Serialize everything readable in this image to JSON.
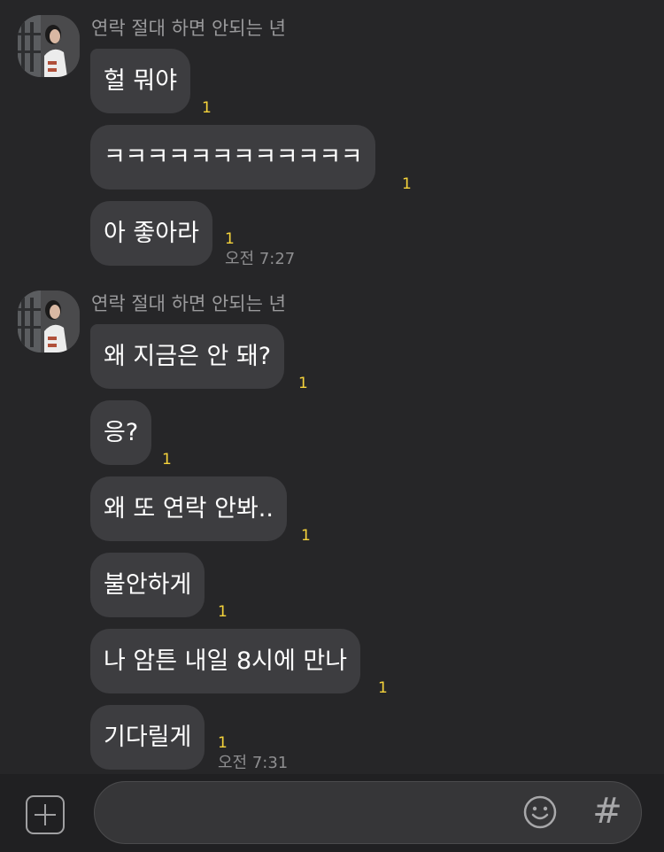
{
  "groups": [
    {
      "sender": "연락 절대 하면 안되는 년",
      "messages": [
        {
          "text": "헐 뭐야",
          "unread": "1"
        },
        {
          "text": "ㅋㅋㅋㅋㅋㅋㅋㅋㅋㅋㅋㅋ",
          "unread": "1"
        },
        {
          "text": "아 좋아라",
          "unread": "1",
          "time": "오전 7:27"
        }
      ]
    },
    {
      "sender": "연락 절대 하면 안되는 년",
      "messages": [
        {
          "text": "왜 지금은 안 돼?",
          "unread": "1"
        },
        {
          "text": "응?",
          "unread": "1"
        },
        {
          "text": "왜 또 연락 안봐..",
          "unread": "1"
        },
        {
          "text": "불안하게",
          "unread": "1"
        },
        {
          "text": "나 암튼 내일 8시에 만나",
          "unread": "1"
        },
        {
          "text": "기다릴게",
          "unread": "1",
          "time": "오전 7:31"
        }
      ]
    }
  ],
  "input_bar": {
    "placeholder": "",
    "attach_icon": "plus-square-icon",
    "emoji_icon": "smiley-icon",
    "hashtag_label": "#"
  },
  "colors": {
    "background": "#262628",
    "bubble": "#3d3d40",
    "unread": "#f5d33b",
    "input_bar": "#202022"
  }
}
